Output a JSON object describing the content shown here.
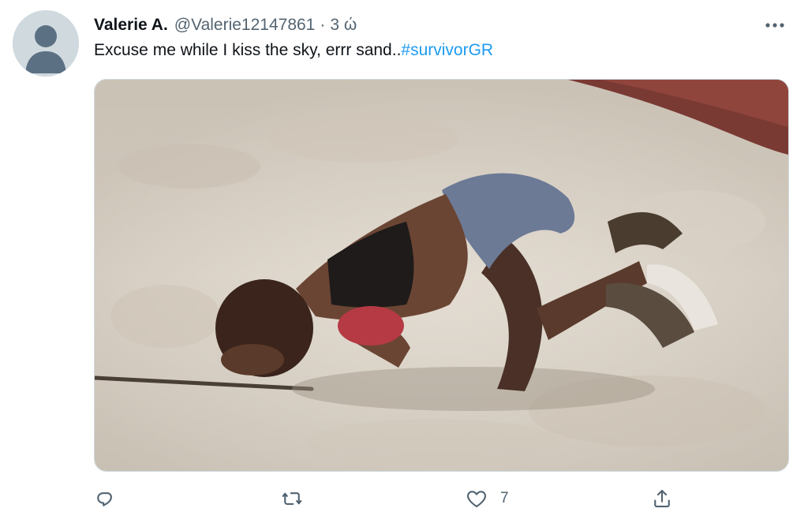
{
  "tweet": {
    "author_name": "Valerie A.",
    "handle": "@Valerie12147861",
    "separator": "·",
    "time": "3 ώ",
    "text_prefix": "Excuse me while I kiss the sky, errr sand..",
    "hashtag": "#survivorGR"
  },
  "actions": {
    "reply_count": "",
    "retweet_count": "",
    "like_count": "7",
    "share_count": ""
  },
  "colors": {
    "link": "#1d9bf0",
    "secondary_text": "#536471",
    "avatar_bg": "#cfd9de"
  },
  "icons": {
    "more": "more-icon",
    "reply": "reply-icon",
    "retweet": "retweet-icon",
    "like": "heart-icon",
    "share": "share-icon"
  }
}
